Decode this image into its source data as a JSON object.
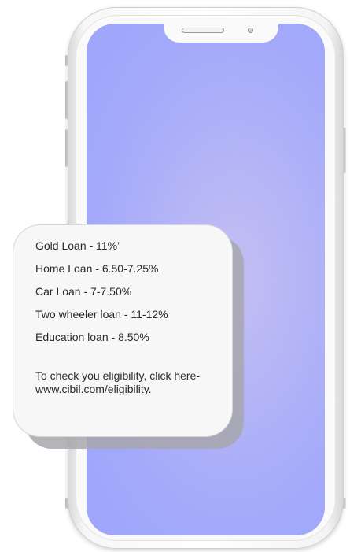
{
  "message": {
    "lines": [
      "Gold Loan - 11%’",
      "Home Loan - 6.50-7.25%",
      "Car Loan - 7-7.50%",
      "Two wheeler loan - 11-12%",
      "Education loan - 8.50%"
    ],
    "footer": "To check you eligibility, click here- www.cibil.com/eligibility."
  },
  "colors": {
    "screen_gradient": [
      "#c4bff2",
      "#9ea6fb"
    ],
    "bubble": "#f7f7f7",
    "bubble_shadow": "#a7a7ad"
  }
}
